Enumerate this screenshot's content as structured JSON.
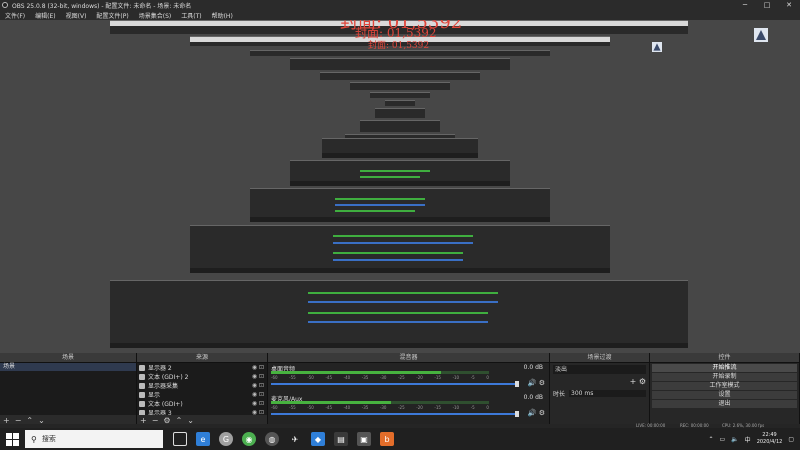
{
  "window": {
    "title": "OBS 25.0.8 (32-bit, windows) - 配置文件: 未命名 - 场景: 未命名",
    "min_glyph": "─",
    "max_glyph": "□",
    "close_glyph": "✕"
  },
  "menu": [
    "文件(F)",
    "编辑(E)",
    "视图(V)",
    "配置文件(P)",
    "场景集合(S)",
    "工具(T)",
    "帮助(H)"
  ],
  "overlay": {
    "line1": "封面: 01,5392",
    "line2": "封面: 01,5392",
    "line3": "封面: 01,5392"
  },
  "docks": {
    "scenes": {
      "title": "场景",
      "items": [
        "场景"
      ]
    },
    "sources": {
      "title": "来源",
      "items": [
        {
          "icon": "display-icon",
          "label": "显示器 2"
        },
        {
          "icon": "text-icon",
          "label": "文本 (GDI+) 2"
        },
        {
          "icon": "capture-icon",
          "label": "显示器采集"
        },
        {
          "icon": "image-icon",
          "label": "显示"
        },
        {
          "icon": "text-icon",
          "label": "文本 (GDI+)"
        },
        {
          "icon": "image-icon",
          "label": "显示器 3"
        }
      ]
    },
    "mixer": {
      "title": "混音器",
      "channels": [
        {
          "label": "桌面音频",
          "db": "0.0 dB",
          "level": 0.78
        },
        {
          "label": "麦克风/Aux",
          "db": "0.0 dB",
          "level": 0.55
        }
      ],
      "ticks": [
        "-60",
        "-55",
        "-50",
        "-45",
        "-40",
        "-35",
        "-30",
        "-25",
        "-20",
        "-15",
        "-10",
        "-5",
        "0"
      ]
    },
    "transitions": {
      "title": "场景过渡",
      "type": "淡出",
      "duration_label": "时长",
      "duration": "300 ms"
    },
    "controls": {
      "title": "控件",
      "buttons": [
        "开始推流",
        "开始录制",
        "工作室模式",
        "设置",
        "退出"
      ]
    }
  },
  "status": {
    "live": "LIVE: 00:00:00",
    "rec": "REC: 00:00:00",
    "cpu": "CPU: 2.6%, 30.00 fps"
  },
  "taskbar": {
    "search_placeholder": "搜索",
    "time": "22:49",
    "date": "2020/4/12"
  }
}
